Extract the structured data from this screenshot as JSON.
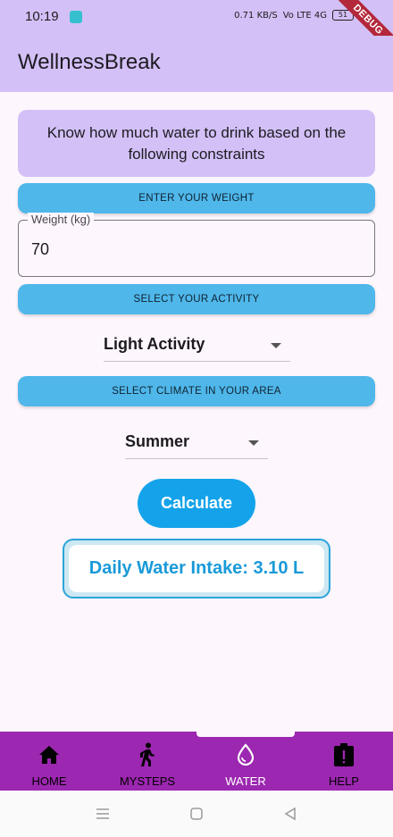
{
  "status": {
    "time": "10:19",
    "net_speed": "0.71 KB/S",
    "net_badges": "Vo LTE 4G",
    "battery": "51"
  },
  "debug_banner": "DEBUG",
  "app": {
    "title": "WellnessBreak"
  },
  "intro": {
    "text": "Know how much water to drink based on the following constraints"
  },
  "weight": {
    "section_label": "ENTER YOUR WEIGHT",
    "field_label": "Weight (kg)",
    "value": "70"
  },
  "activity": {
    "section_label": "SELECT YOUR ACTIVITY",
    "selected": "Light Activity"
  },
  "climate": {
    "section_label": "SELECT CLIMATE IN YOUR AREA",
    "selected": "Summer"
  },
  "calculate_label": "Calculate",
  "result": {
    "text": "Daily Water Intake: 3.10 L"
  },
  "nav": {
    "items": [
      {
        "label": "HOME",
        "icon": "home-icon"
      },
      {
        "label": "MYSTEPS",
        "icon": "walking-icon"
      },
      {
        "label": "WATER",
        "icon": "water-drop-icon",
        "active": true
      },
      {
        "label": "HELP",
        "icon": "help-clipboard-icon"
      }
    ]
  },
  "colors": {
    "appbar": "#d3c0f7",
    "accent": "#4fb7ea",
    "primary_button": "#14a3ea",
    "nav_bg": "#9c27b0"
  }
}
